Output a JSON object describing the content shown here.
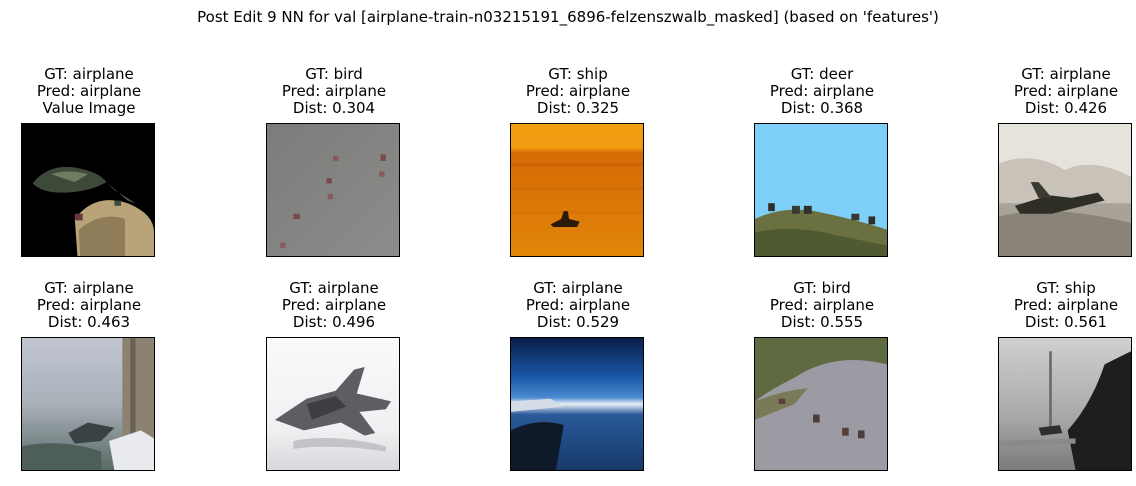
{
  "title": "Post Edit 9 NN for val [airplane-train-n03215191_6896-felzenszwalb_masked] (based on 'features')",
  "panels": [
    {
      "gt": "GT: airplane",
      "pred": "Pred: airplane",
      "extra": "Value Image",
      "scene": "masked-plane"
    },
    {
      "gt": "GT: bird",
      "pred": "Pred: airplane",
      "extra": "Dist: 0.304",
      "scene": "gray-birds"
    },
    {
      "gt": "GT: ship",
      "pred": "Pred: airplane",
      "extra": "Dist: 0.325",
      "scene": "orange-sea-ship"
    },
    {
      "gt": "GT: deer",
      "pred": "Pred: airplane",
      "extra": "Dist: 0.368",
      "scene": "deer-on-hill"
    },
    {
      "gt": "GT: airplane",
      "pred": "Pred: airplane",
      "extra": "Dist: 0.426",
      "scene": "jet-over-mountains"
    },
    {
      "gt": "GT: airplane",
      "pred": "Pred: airplane",
      "extra": "Dist: 0.463",
      "scene": "cockpit-view"
    },
    {
      "gt": "GT: airplane",
      "pred": "Pred: airplane",
      "extra": "Dist: 0.496",
      "scene": "stealth-jet"
    },
    {
      "gt": "GT: airplane",
      "pred": "Pred: airplane",
      "extra": "Dist: 0.529",
      "scene": "wing-over-clouds"
    },
    {
      "gt": "GT: bird",
      "pred": "Pred: airplane",
      "extra": "Dist: 0.555",
      "scene": "birds-on-grass"
    },
    {
      "gt": "GT: ship",
      "pred": "Pred: airplane",
      "extra": "Dist: 0.561",
      "scene": "gray-harbor"
    }
  ]
}
